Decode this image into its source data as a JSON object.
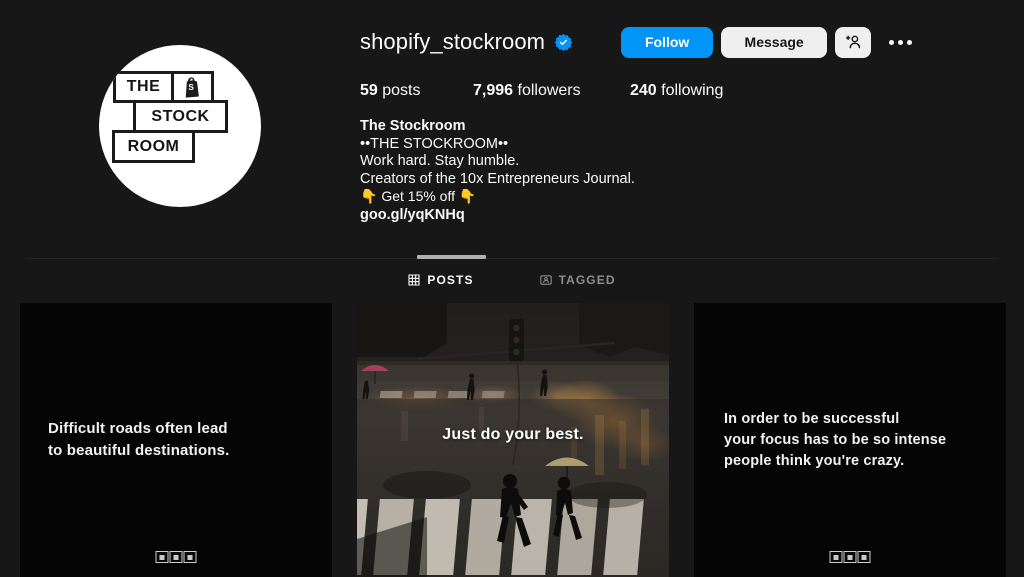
{
  "profile": {
    "username": "shopify_stockroom",
    "verified": true,
    "verified_icon": "verified-badge-icon",
    "avatar": {
      "logo_line_1": "THE",
      "logo_icon": "shopify-bag-icon",
      "logo_line_2": "STOCK",
      "logo_line_3": "ROOM"
    },
    "actions": {
      "follow_label": "Follow",
      "message_label": "Message",
      "add_person_icon": "person-add-icon",
      "more_options_icon": "more-options-icon"
    },
    "stats": [
      {
        "count": "59",
        "label": "posts"
      },
      {
        "count": "7,996",
        "label": "followers"
      },
      {
        "count": "240",
        "label": "following"
      }
    ],
    "bio": {
      "full_name": "The Stockroom",
      "line_1": "••THE STOCKROOM••",
      "line_2": "Work hard. Stay humble.",
      "line_3": "Creators of the 10x Entrepreneurs Journal.",
      "line_4": "👇 Get 15% off 👇",
      "link": "goo.gl/yqKNHq"
    }
  },
  "tabs": [
    {
      "label": "POSTS",
      "icon": "grid-icon",
      "active": true
    },
    {
      "label": "TAGGED",
      "icon": "tagged-person-icon",
      "active": false
    }
  ],
  "posts": [
    {
      "type": "quote",
      "text": "Difficult roads often lead\nto beautiful destinations.",
      "watermark": "stockroom-watermark-icon"
    },
    {
      "type": "photo",
      "caption": "Just do your best.",
      "description": "rainy-city-crosswalk-at-night"
    },
    {
      "type": "quote",
      "text": "In order to be successful\nyour focus has to be so intense\npeople think you're crazy.",
      "watermark": "stockroom-watermark-icon"
    }
  ],
  "colors": {
    "background": "#171717",
    "follow_button": "#0095f6",
    "secondary_button": "#efefef",
    "verified_blue": "#0095f6",
    "text_primary": "#fafafa",
    "text_muted": "#8e8e8e"
  }
}
